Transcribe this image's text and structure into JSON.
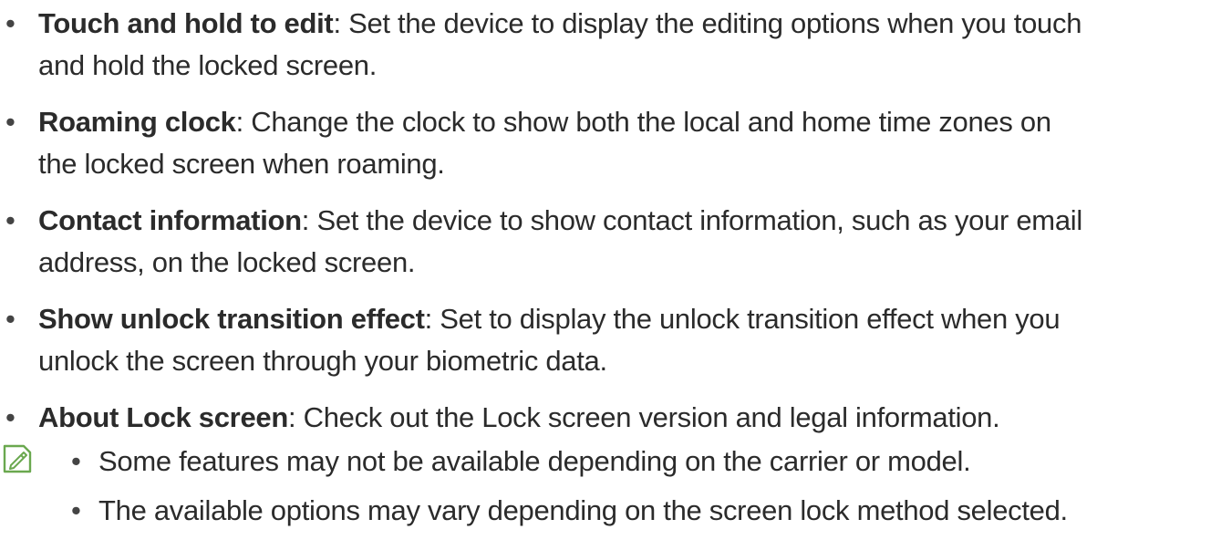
{
  "bullet_glyph": "•",
  "items": [
    {
      "term": "Touch and hold to edit",
      "line1": "Set the device to display the editing options when you touch",
      "line2": "and hold the locked screen."
    },
    {
      "term": "Roaming clock",
      "line1": "Change the clock to show both the local and home time zones on",
      "line2": "the locked screen when roaming."
    },
    {
      "term": "Contact information",
      "line1": "Set the device to show contact information, such as your email",
      "line2": "address, on the locked screen."
    },
    {
      "term": "Show unlock transition effect",
      "line1": "Set to display the unlock transition effect when you",
      "line2": "unlock the screen through your biometric data."
    },
    {
      "term": "About Lock screen",
      "line1": "Check out the Lock screen version and legal information."
    }
  ],
  "note": {
    "icon": "note-pencil-icon",
    "icon_color": "#6aa84f",
    "items": [
      "Some features may not be available depending on the carrier or model.",
      "The available options may vary depending on the screen lock method selected."
    ]
  }
}
